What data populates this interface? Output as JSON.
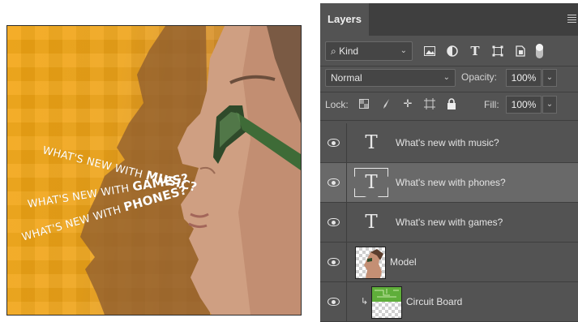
{
  "canvas": {
    "text_lines": [
      {
        "normal": "WHAT'S NEW WITH ",
        "bold": "MUSIC?"
      },
      {
        "normal": "WHAT'S NEW WITH ",
        "bold": "GAMES?"
      },
      {
        "normal": "WHAT'S NEW WITH ",
        "bold": "PHONES?"
      }
    ]
  },
  "panel": {
    "tab_label": "Layers",
    "menu_icon": "panel-menu-icon",
    "filter": {
      "kind_label": "Kind",
      "icons": [
        "image-filter-icon",
        "adjustment-filter-icon",
        "type-filter-icon",
        "shape-filter-icon",
        "smart-object-filter-icon"
      ]
    },
    "blend_mode": "Normal",
    "opacity_label": "Opacity:",
    "opacity_value": "100%",
    "lock_label": "Lock:",
    "lock_icons": [
      "lock-transparent-icon",
      "lock-image-icon",
      "lock-position-icon",
      "lock-artboard-icon",
      "lock-all-icon"
    ],
    "fill_label": "Fill:",
    "fill_value": "100%",
    "layers": [
      {
        "name": "What's new with music?",
        "type": "text",
        "selected": false
      },
      {
        "name": "What's new with phones?",
        "type": "text",
        "selected": true
      },
      {
        "name": "What's new with games?",
        "type": "text",
        "selected": false
      },
      {
        "name": "Model",
        "type": "image",
        "selected": false
      },
      {
        "name": "Circuit Board",
        "type": "image-clipped",
        "selected": false
      }
    ]
  }
}
